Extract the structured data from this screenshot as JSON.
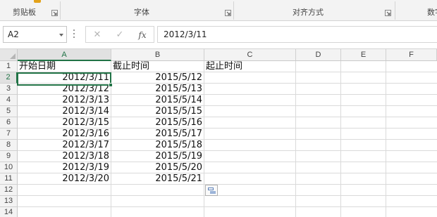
{
  "ribbon": {
    "groups": [
      {
        "label": "剪贴板"
      },
      {
        "label": "字体"
      },
      {
        "label": "对齐方式"
      },
      {
        "label": "数字"
      }
    ]
  },
  "formula_bar": {
    "name_box": "A2",
    "cancel_icon": "✕",
    "enter_icon": "✓",
    "fx_label": "fx",
    "formula": "2012/3/11"
  },
  "sheet": {
    "columns": [
      "A",
      "B",
      "C",
      "D",
      "E",
      "F"
    ],
    "rows": [
      "1",
      "2",
      "3",
      "4",
      "5",
      "6",
      "7",
      "8",
      "9",
      "10",
      "11",
      "12",
      "13",
      "14"
    ],
    "active_cell": "A2",
    "header_row": [
      "开始日期",
      "截止时间",
      "起止时间"
    ],
    "data": [
      [
        "2012/3/11",
        "2015/5/12"
      ],
      [
        "2012/3/12",
        "2015/5/13"
      ],
      [
        "2012/3/13",
        "2015/5/14"
      ],
      [
        "2012/3/14",
        "2015/5/15"
      ],
      [
        "2012/3/15",
        "2015/5/16"
      ],
      [
        "2012/3/16",
        "2015/5/17"
      ],
      [
        "2012/3/17",
        "2015/5/18"
      ],
      [
        "2012/3/18",
        "2015/5/19"
      ],
      [
        "2012/3/19",
        "2015/5/20"
      ],
      [
        "2012/3/20",
        "2015/5/21"
      ]
    ]
  },
  "colors": {
    "accent": "#217346",
    "gridline": "#dadada",
    "header_bg": "#f3f3f3"
  }
}
